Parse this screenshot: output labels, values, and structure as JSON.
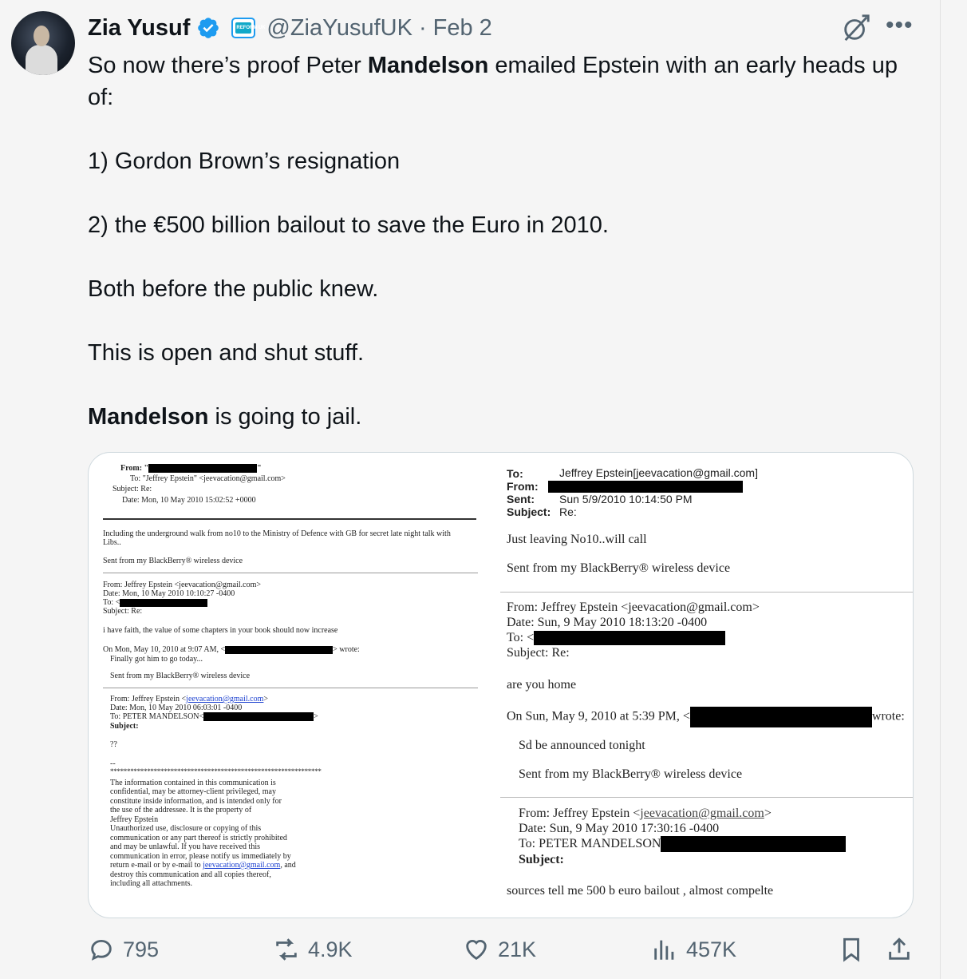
{
  "author": {
    "name": "Zia Yusuf",
    "handle": "@ZiaYusufUK",
    "separator": "·",
    "date": "Feb 2",
    "affiliate_badge_text": "REFORM UK"
  },
  "tweet_text": {
    "line1_pre": "So now there’s proof Peter ",
    "line1_bold": "Mandelson",
    "line1_post": " emailed Epstein with an early heads up of:",
    "item1": "1) Gordon Brown’s resignation",
    "item2": "2) the €500 billion bailout to save the Euro in 2010.",
    "line3": "Both before the public knew.",
    "line4": "This is open and shut stuff.",
    "line5_bold": "Mandelson",
    "line5_post": " is going to jail."
  },
  "left_doc": {
    "from_label": "From: \"",
    "from_end": "\"",
    "to_line": "To: \"Jeffrey Epstein\" <jeevacation@gmail.com>",
    "subject_line": "Subject: Re:",
    "date_line": "Date: Mon, 10 May 2010 15:02:52 +0000",
    "body1": "Including the underground walk from no10 to the Ministry of Defence with GB for secret late night talk with",
    "body1b": "Libs..",
    "sig1": "Sent from my BlackBerry® wireless device",
    "from2": "From: Jeffrey Epstein <jeevacation@gmail.com>",
    "date2": "Date: Mon, 10 May 2010 10:10:27 -0400",
    "to2": "To: <",
    "subject2": "Subject: Re:",
    "body2": "i have faith, the value of some chapters in your book should now increase",
    "onmon": "On Mon, May 10, 2010 at 9:07 AM, <",
    "wrote": "> wrote:",
    "quote1": "Finally got him to go today...",
    "sig2": "Sent from my BlackBerry® wireless device",
    "from3_pre": "From: Jeffrey Epstein <",
    "from3_link": "jeevacation@gmail.com",
    "from3_post": ">",
    "date3": "Date: Mon, 10 May 2010 06:03:01 -0400",
    "to3": "To: PETER MANDELSON<",
    "to3_end": ">",
    "subject3": "Subject:",
    "qq": "??",
    "dash": "--",
    "stars": "***************************************************************",
    "disclaimer": [
      "The information contained in this communication is",
      "confidential, may be attorney-client privileged, may",
      "constitute inside information, and is intended only for",
      "the use of the addressee. It is the property of",
      "Jeffrey Epstein",
      "Unauthorized use, disclosure or copying of this",
      "communication or any part thereof is strictly prohibited",
      "and may be unlawful. If you have received this",
      "communication in error, please notify us immediately by"
    ],
    "disc_last_pre": "return e-mail or by e-mail to ",
    "disc_last_link": "jeevacation@gmail.com",
    "disc_last_post": ", and",
    "disc_end1": "destroy this communication and all copies thereof,",
    "disc_end2": "including all attachments."
  },
  "right_doc": {
    "to_label": "To:",
    "to_value": "Jeffrey Epstein[jeevacation@gmail.com]",
    "from_label": "From:",
    "sent_label": "Sent:",
    "sent_value": "Sun 5/9/2010 10:14:50 PM",
    "subject_label": "Subject:",
    "subject_value": "Re:",
    "body1": "Just leaving No10..will call",
    "sig1": "Sent from my BlackBerry® wireless device",
    "from2": "From: Jeffrey Epstein <jeevacation@gmail.com>",
    "date2": "Date: Sun, 9 May 2010 18:13:20 -0400",
    "to2": "To: <",
    "subject2": "Subject: Re:",
    "body2": "are you home",
    "onsun": "On Sun, May 9, 2010 at 5:39 PM, <",
    "wrote": "wrote:",
    "quote1": "Sd be announced tonight",
    "sig2": "Sent from my BlackBerry® wireless device",
    "from3_pre": "From: Jeffrey Epstein <",
    "from3_link": "jeevacation@gmail.com",
    "from3_post": ">",
    "date3": "Date: Sun, 9 May 2010 17:30:16 -0400",
    "to3": "To: PETER MANDELSON",
    "subject3": "Subject:",
    "body3": "sources tell me 500 b euro bailout , almost compelte"
  },
  "actions": {
    "replies": "795",
    "reposts": "4.9K",
    "likes": "21K",
    "views": "457K"
  },
  "colors": {
    "accent": "#1d9bf0",
    "muted": "#536471",
    "text": "#0f1419"
  }
}
